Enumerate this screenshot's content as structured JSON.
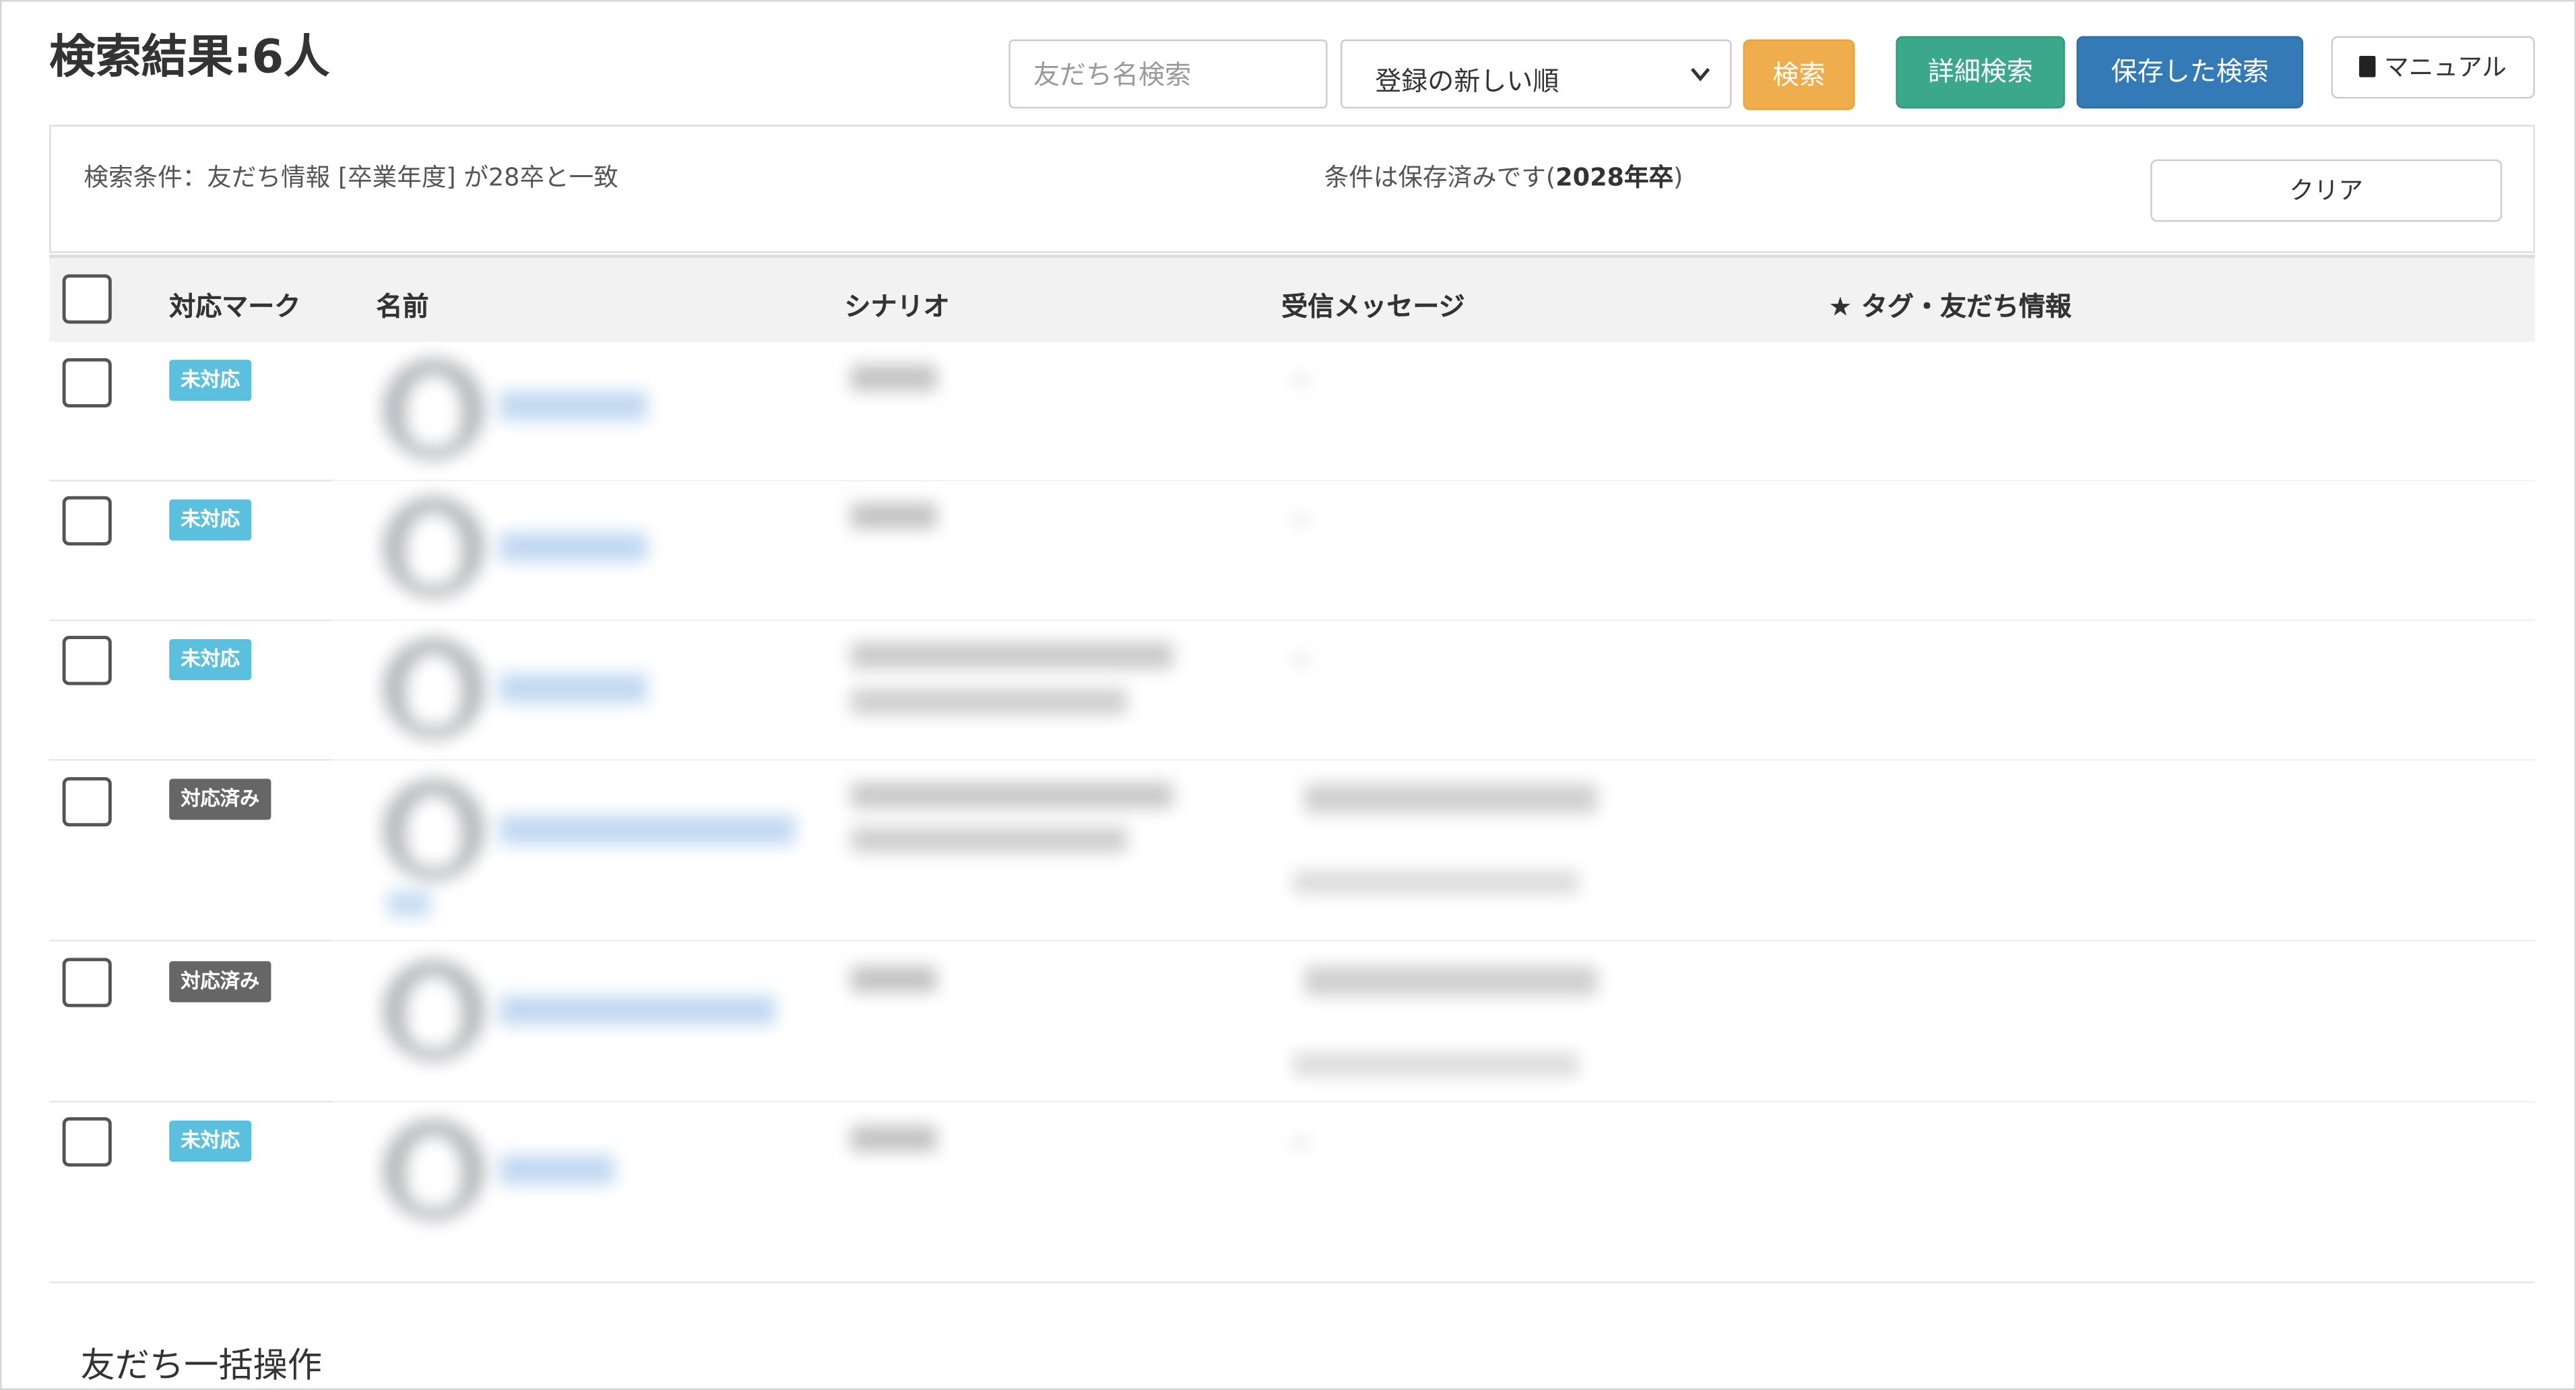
{
  "header": {
    "title": "検索結果:6人",
    "search_placeholder": "友だち名検索",
    "sort_selected": "登録の新しい順",
    "search_button": "検索",
    "detail_search_button": "詳細検索",
    "saved_search_button": "保存した検索",
    "manual_button": "マニュアル"
  },
  "conditions": {
    "text": "検索条件：友だち情報 [卒業年度] が28卒と一致",
    "saved_prefix": "条件は保存済みです(",
    "saved_name": "2028年卒",
    "saved_suffix": ")",
    "clear_button": "クリア"
  },
  "table": {
    "columns": {
      "mark": "対応マーク",
      "name": "名前",
      "scenario": "シナリオ",
      "message": "受信メッセージ",
      "tags": "★ タグ・友だち情報"
    },
    "rows": [
      {
        "mark": "未対応",
        "status": "pending",
        "name": "",
        "scenario": "",
        "message": ""
      },
      {
        "mark": "未対応",
        "status": "pending",
        "name": "",
        "scenario": "",
        "message": ""
      },
      {
        "mark": "未対応",
        "status": "pending",
        "name": "",
        "scenario": "",
        "message": ""
      },
      {
        "mark": "対応済み",
        "status": "done",
        "name": "",
        "scenario": "",
        "message": ""
      },
      {
        "mark": "対応済み",
        "status": "done",
        "name": "",
        "scenario": "",
        "message": ""
      },
      {
        "mark": "未対応",
        "status": "pending",
        "name": "",
        "scenario": "",
        "message": ""
      }
    ]
  },
  "bulk": {
    "title": "友だち一括操作"
  },
  "colors": {
    "pending_badge": "#5bc0de",
    "done_badge": "#666666",
    "search_button": "#f0ad4e",
    "detail_button": "#3aa889",
    "saved_button": "#337ab7"
  }
}
